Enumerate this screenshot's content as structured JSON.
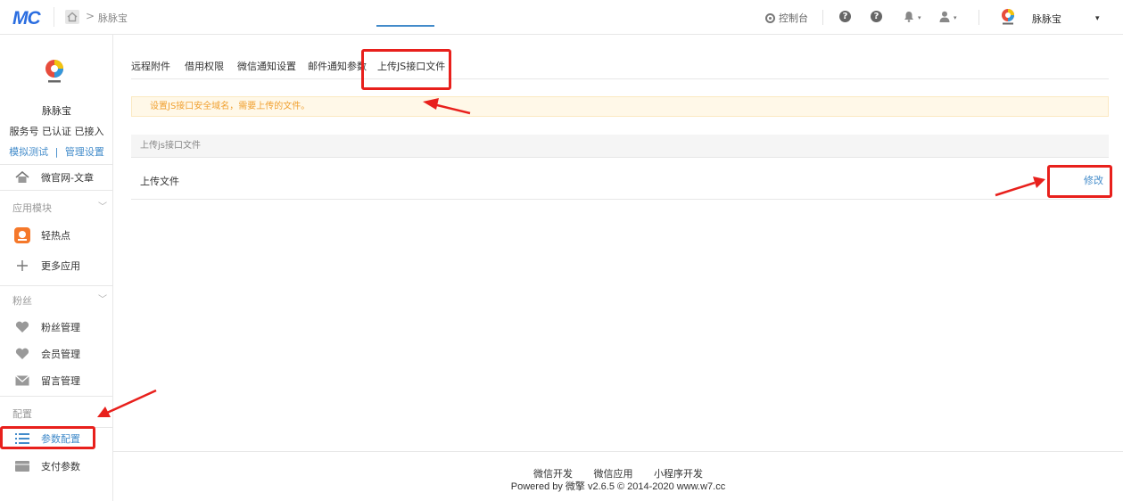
{
  "topbar": {
    "logo": "MC",
    "breadcrumb_sep": ">",
    "breadcrumb": "脉脉宝",
    "console_label": "控制台",
    "help1": "?",
    "help2": "?",
    "bell_caret": "▾",
    "user_caret": "▾",
    "account_name": "脉脉宝",
    "account_caret": "▾"
  },
  "sidebar": {
    "account": {
      "name": "脉脉宝",
      "status": "服务号 已认证 已接入",
      "link_test": "模拟测试",
      "link_sep": "|",
      "link_manage": "管理设置"
    },
    "top_item": {
      "label": "微官网-文章",
      "icon": "home-icon"
    },
    "sections": [
      {
        "title": "应用模块",
        "items": [
          {
            "label": "轻热点",
            "icon": "app-icon"
          },
          {
            "label": "更多应用",
            "icon": "plus-icon"
          }
        ]
      },
      {
        "title": "粉丝",
        "items": [
          {
            "label": "粉丝管理",
            "icon": "heart-icon"
          },
          {
            "label": "会员管理",
            "icon": "heart-icon"
          },
          {
            "label": "留言管理",
            "icon": "mail-icon"
          }
        ]
      },
      {
        "title": "配置",
        "items": [
          {
            "label": "参数配置",
            "icon": "list-icon",
            "active": true
          },
          {
            "label": "支付参数",
            "icon": "card-icon"
          }
        ]
      }
    ]
  },
  "tabs": [
    {
      "label": "远程附件"
    },
    {
      "label": "借用权限"
    },
    {
      "label": "微信通知设置"
    },
    {
      "label": "邮件通知参数"
    },
    {
      "label": "上传JS接口文件",
      "active": true
    }
  ],
  "notice": "设置JS接口安全域名，需要上传的文件。",
  "panel": {
    "header": "上传js接口文件",
    "row_label": "上传文件",
    "row_action": "修改"
  },
  "footer": {
    "links": [
      "微信开发",
      "微信应用",
      "小程序开发"
    ],
    "copyright": "Powered by 微擎 v2.6.5 © 2014-2020 www.w7.cc"
  },
  "colors": {
    "accent": "#428bca",
    "annotation_red": "#e8201c",
    "notice_text": "#f0a030",
    "notice_bg": "#fff8e8"
  }
}
